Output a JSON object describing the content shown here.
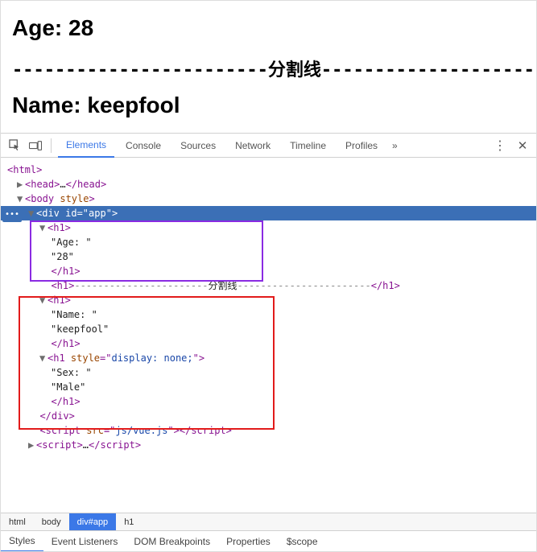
{
  "page": {
    "heading_age_label": "Age: ",
    "heading_age_value": "28",
    "divider_left": "------------------------",
    "divider_text": "分割线",
    "divider_right": "----------------------",
    "heading_name_label": "Name: ",
    "heading_name_value": "keepfool"
  },
  "devtools": {
    "tabs": {
      "elements": "Elements",
      "console": "Console",
      "sources": "Sources",
      "network": "Network",
      "timeline": "Timeline",
      "profiles": "Profiles",
      "more": "»"
    },
    "expand_ellipsis": "…",
    "breadcrumb": {
      "html": "html",
      "body": "body",
      "divapp": "div#app",
      "h1": "h1"
    },
    "subtabs": {
      "styles": "Styles",
      "event_listeners": "Event Listeners",
      "dom_breakpoints": "DOM Breakpoints",
      "properties": "Properties",
      "scope": "$scope"
    }
  },
  "dom": {
    "html_open": "<html>",
    "head": {
      "open": "<head>",
      "ell": "…",
      "close": "</head>"
    },
    "body_open": "<body ",
    "body_attr": "style",
    "body_end": ">",
    "div_open": "<div ",
    "div_attr_id": "id",
    "div_eq": "=\"",
    "div_id_val": "app",
    "div_q_end": "\">",
    "h1_open": "<h1>",
    "h1_close": "</h1>",
    "age_label": "\"Age: \"",
    "age_value": "\"28\"",
    "divider_row_left": "<h1>-----------------------",
    "divider_row_mid": "分割线",
    "divider_row_right": "-----------------------</h1>",
    "name_label": "\"Name: \"",
    "name_value": "\"keepfool\"",
    "h1_style_open": "<h1 ",
    "h1_style_attr": "style",
    "h1_style_eq": "=\"",
    "h1_style_val": "display: none;",
    "h1_style_end": "\">",
    "sex_label": "\"Sex: \"",
    "sex_value": "\"Male\"",
    "div_close": "</div>",
    "script1_open": "<script ",
    "script1_attr": "src",
    "script1_eq": "=\"",
    "script1_val": "js/vue.js",
    "script1_end": "\">",
    "script_close": "</script>",
    "script2_open": "<script>",
    "script2_ell": "…"
  }
}
